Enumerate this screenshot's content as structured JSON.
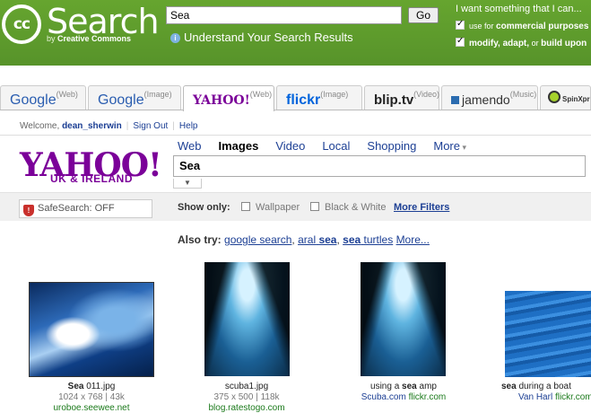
{
  "cc": {
    "logo_text": "cc",
    "title": "Search",
    "subtitle_by": "by",
    "subtitle_org": "Creative Commons",
    "query": "Sea",
    "go_label": "Go",
    "understand_link": "Understand Your Search Results",
    "want_label": "I want something that I can...",
    "check1_pre": "use for",
    "check1_bold": "commercial purposes",
    "check2_bold1": "modify, adapt,",
    "check2_mid": "or",
    "check2_bold2": "build upon"
  },
  "tabs": [
    {
      "name": "Google",
      "sup": "(Web)"
    },
    {
      "name": "Google",
      "sup": "(Image)"
    },
    {
      "name": "YAHOO!",
      "sup": "(Web)"
    },
    {
      "name": "flickr",
      "sup": "(Image)"
    },
    {
      "name": "blip.tv",
      "sup": "(Video)"
    },
    {
      "name": "jamendo",
      "sup": "(Music)"
    },
    {
      "name": "SpinXpress",
      "sup": ""
    }
  ],
  "yahoo": {
    "welcome": "Welcome,",
    "username": "dean_sherwin",
    "sign_out": "Sign Out",
    "help": "Help",
    "nav": [
      "Web",
      "Images",
      "Video",
      "Local",
      "Shopping",
      "More"
    ],
    "logo": "YAHOO!",
    "logo_sub": "UK & IRELAND",
    "query": "Sea",
    "safesearch": "SafeSearch: OFF",
    "show_only": "Show only:",
    "filters": [
      "Wallpaper",
      "Black & White"
    ],
    "more_filters": "More Filters",
    "also_try_label": "Also try:",
    "also_try": {
      "s1": "google search",
      "s2_pre": "aral",
      "s2_bold": "sea",
      "s3_bold": "sea",
      "s3_post": "turtles",
      "more": "More..."
    }
  },
  "results": [
    {
      "title_bold": "Sea",
      "title_rest": "011.jpg",
      "dims": "1024 x 768 | 43k",
      "source": "uroboe.seewee.net",
      "image": "ocean-wave"
    },
    {
      "title_bold": "",
      "title_rest": "scuba1.jpg",
      "dims": "375 x 500 | 118k",
      "source": "blog.ratestogo.com",
      "image": "underwater-cave"
    },
    {
      "title_pre": "using a",
      "title_bold": "sea",
      "title_rest": "amp",
      "source_link": "Scuba.com",
      "source_site": "flickr.com",
      "image": "underwater-cave"
    },
    {
      "title_bold": "sea",
      "title_rest": "during a boat",
      "source_link": "Van Harl",
      "source_site": "flickr.com",
      "image": "sea-surface"
    }
  ]
}
